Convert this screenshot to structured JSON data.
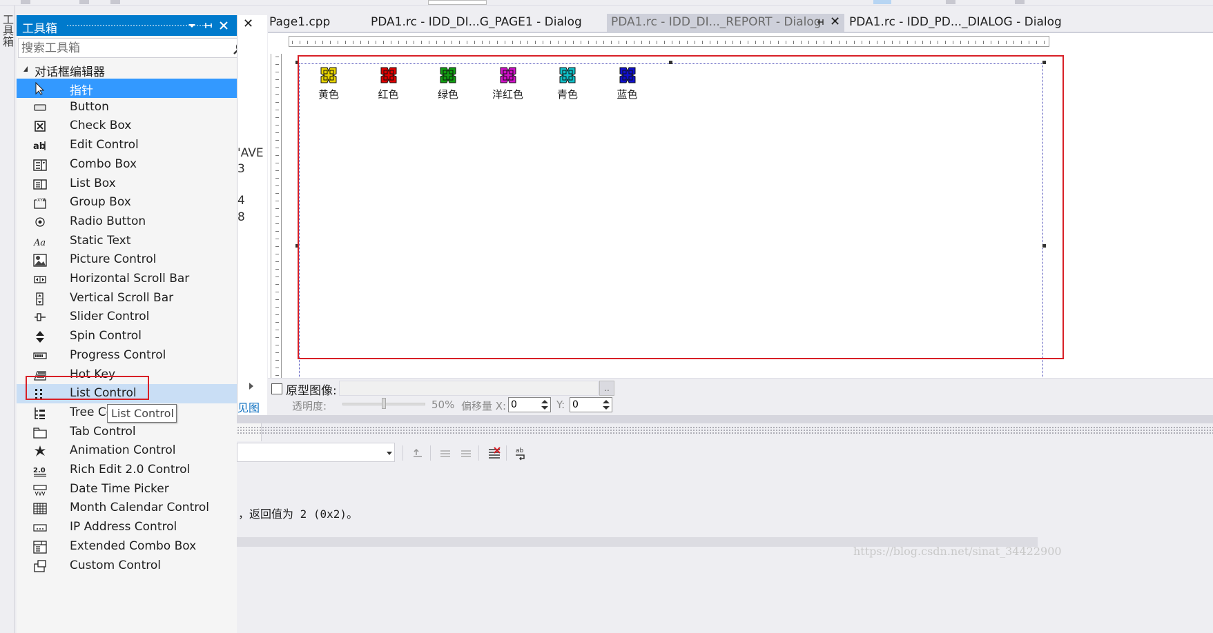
{
  "left_strip": {
    "label": "工具箱"
  },
  "toolbox": {
    "title": "工具箱",
    "search_placeholder": "搜索工具箱",
    "section": "对话框编辑器",
    "items": [
      {
        "label": "指针",
        "icon": "pointer-icon",
        "state": "selected"
      },
      {
        "label": "Button",
        "icon": "button-icon"
      },
      {
        "label": "Check Box",
        "icon": "checkbox-icon"
      },
      {
        "label": "Edit Control",
        "icon": "edit-control-icon"
      },
      {
        "label": "Combo Box",
        "icon": "combobox-icon"
      },
      {
        "label": "List Box",
        "icon": "listbox-icon"
      },
      {
        "label": "Group Box",
        "icon": "groupbox-icon"
      },
      {
        "label": "Radio Button",
        "icon": "radio-icon"
      },
      {
        "label": "Static Text",
        "icon": "static-text-icon"
      },
      {
        "label": "Picture Control",
        "icon": "picture-icon"
      },
      {
        "label": "Horizontal Scroll Bar",
        "icon": "hscroll-icon"
      },
      {
        "label": "Vertical Scroll Bar",
        "icon": "vscroll-icon"
      },
      {
        "label": "Slider Control",
        "icon": "slider-icon"
      },
      {
        "label": "Spin Control",
        "icon": "spin-icon"
      },
      {
        "label": "Progress Control",
        "icon": "progress-icon"
      },
      {
        "label": "Hot Key",
        "icon": "hotkey-icon"
      },
      {
        "label": "List Control",
        "icon": "list-control-icon",
        "state": "hover"
      },
      {
        "label": "Tree Control",
        "icon": "tree-icon"
      },
      {
        "label": "Tab Control",
        "icon": "tab-icon"
      },
      {
        "label": "Animation Control",
        "icon": "animation-icon"
      },
      {
        "label": "Rich Edit 2.0 Control",
        "icon": "richedit-icon"
      },
      {
        "label": "Date Time Picker",
        "icon": "datetime-icon"
      },
      {
        "label": "Month Calendar Control",
        "icon": "calendar-icon"
      },
      {
        "label": "IP Address Control",
        "icon": "ipaddress-icon"
      },
      {
        "label": "Extended Combo Box",
        "icon": "ext-combo-icon"
      },
      {
        "label": "Custom Control",
        "icon": "custom-control-icon"
      }
    ],
    "tooltip": "List Control"
  },
  "mid_panel": {
    "lines": [
      "'AVE",
      "3",
      "4",
      "8"
    ],
    "view_link": "见图"
  },
  "tabs": [
    {
      "label": "Page1.cpp"
    },
    {
      "label": "PDA1.rc - IDD_DI...G_PAGE1 - Dialog"
    },
    {
      "label": "PDA1.rc - IDD_DI..._REPORT - Dialog",
      "active": true
    },
    {
      "label": "PDA1.rc - IDD_PD..._DIALOG - Dialog"
    }
  ],
  "dialog": {
    "color_items": [
      {
        "label": "黄色",
        "color": "#e8d400"
      },
      {
        "label": "红色",
        "color": "#e00000"
      },
      {
        "label": "绿色",
        "color": "#10a010"
      },
      {
        "label": "洋红色",
        "color": "#d010c8"
      },
      {
        "label": "青色",
        "color": "#10c0c8"
      },
      {
        "label": "蓝色",
        "color": "#1010d0"
      }
    ]
  },
  "proto": {
    "label": "原型图像:",
    "browse": "..",
    "opacity_label": "透明度:",
    "opacity_value": "50%",
    "opacity_fraction": 0.5,
    "offset_x_label": "偏移量 X:",
    "offset_x": "0",
    "offset_y_label": "Y:",
    "offset_y": "0"
  },
  "output": {
    "text": "，返回值为 2 (0x2)。"
  },
  "watermark": "https://blog.csdn.net/sinat_34422900",
  "colors": {
    "accent": "#007acc",
    "selection": "#3399ff",
    "hover": "#c9def5",
    "highlight_red": "#d81f26"
  }
}
